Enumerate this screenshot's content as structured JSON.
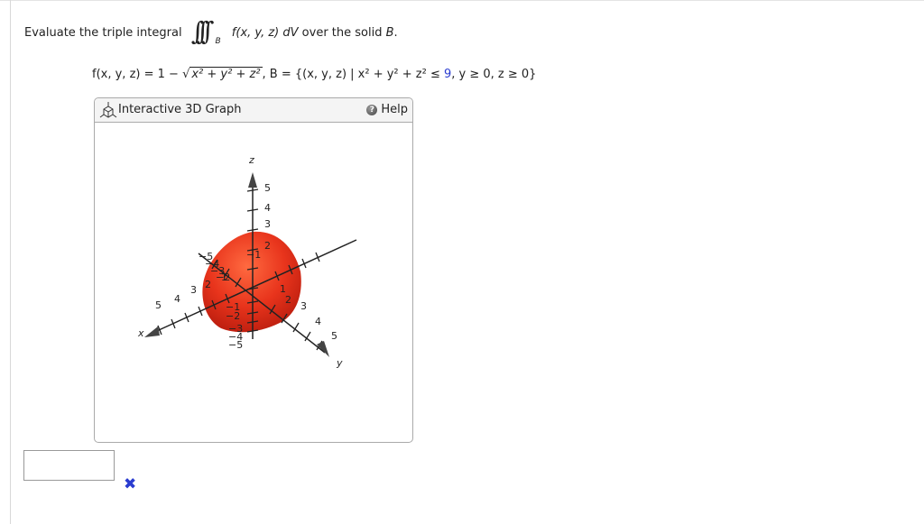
{
  "question": {
    "prefix": "Evaluate the triple integral",
    "integral_symbol": "∫∫∫",
    "region_subscript": "B",
    "integrand": "f(x, y, z) dV",
    "suffix": "over the solid",
    "solid": "B",
    "period": "."
  },
  "definition": {
    "f_lhs": "f(x, y, z) = 1 −",
    "sqrt_body": "x² + y² + z²",
    "separator": ", B = {(x, y, z) | x² + y² + z² ≤",
    "radius_sq": "9",
    "constraints": ", y ≥ 0, z ≥ 0}"
  },
  "panel": {
    "title": "Interactive 3D Graph",
    "help_label": "Help",
    "icon": "cube-3d-icon",
    "help_icon": "question-circle-icon"
  },
  "graph": {
    "surface_color": "#e8341c",
    "axis_labels": {
      "x": "x",
      "y": "y",
      "z": "z"
    },
    "z_ticks_pos": [
      "2",
      "3",
      "4",
      "5"
    ],
    "z_ticks_neg": [
      "−1",
      "−2",
      "−3",
      "−4",
      "−5"
    ],
    "x_ticks_pos": [
      "3",
      "4",
      "5"
    ],
    "x_ticks_inner": [
      "2",
      "1"
    ],
    "y_ticks_pos": [
      "1",
      "2",
      "3",
      "4",
      "5"
    ],
    "back_ticks": [
      "−5",
      "−4",
      "−3",
      "−2",
      "−1"
    ]
  },
  "answer": {
    "value": "",
    "status_icon": "incorrect-x-icon",
    "status_color": "#2a3cd0"
  }
}
